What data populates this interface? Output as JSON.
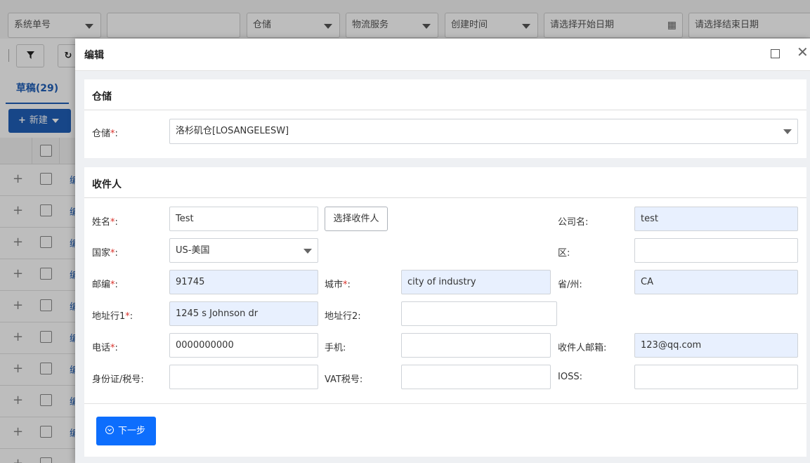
{
  "background": {
    "filters": {
      "order_type": "系统单号",
      "order_value": "",
      "warehouse": "仓储",
      "logistics": "物流服务",
      "time_type": "创建时间",
      "start_date_placeholder": "请选择开始日期",
      "end_date_placeholder": "请选择结束日期"
    },
    "tab_draft": "草稿(29)",
    "new_button": "新建",
    "row_link_text": "编"
  },
  "modal": {
    "title": "编辑",
    "warehouse_section": {
      "title": "仓储",
      "label": "仓储",
      "value": "洛杉矶仓[LOSANGELESW]"
    },
    "recipient_section": {
      "title": "收件人",
      "name_label": "姓名",
      "name_value": "Test",
      "pick_button": "选择收件人",
      "company_label": "公司名",
      "company_value": "test",
      "country_label": "国家",
      "country_value": "US-美国",
      "district_label": "区",
      "district_value": "",
      "zip_label": "邮编",
      "zip_value": "91745",
      "city_label": "城市",
      "city_value": "city of industry",
      "state_label": "省/州",
      "state_value": "CA",
      "addr1_label": "地址行1",
      "addr1_value": "1245 s Johnson dr",
      "addr2_label": "地址行2",
      "addr2_value": "",
      "phone_label": "电话",
      "phone_value": "0000000000",
      "mobile_label": "手机",
      "mobile_value": "",
      "email_label": "收件人邮箱",
      "email_value": "123@qq.com",
      "id_label": "身份证/税号",
      "id_value": "",
      "vat_label": "VAT税号",
      "vat_value": "",
      "ioss_label": "IOSS",
      "ioss_value": ""
    },
    "next_button": "下一步"
  }
}
